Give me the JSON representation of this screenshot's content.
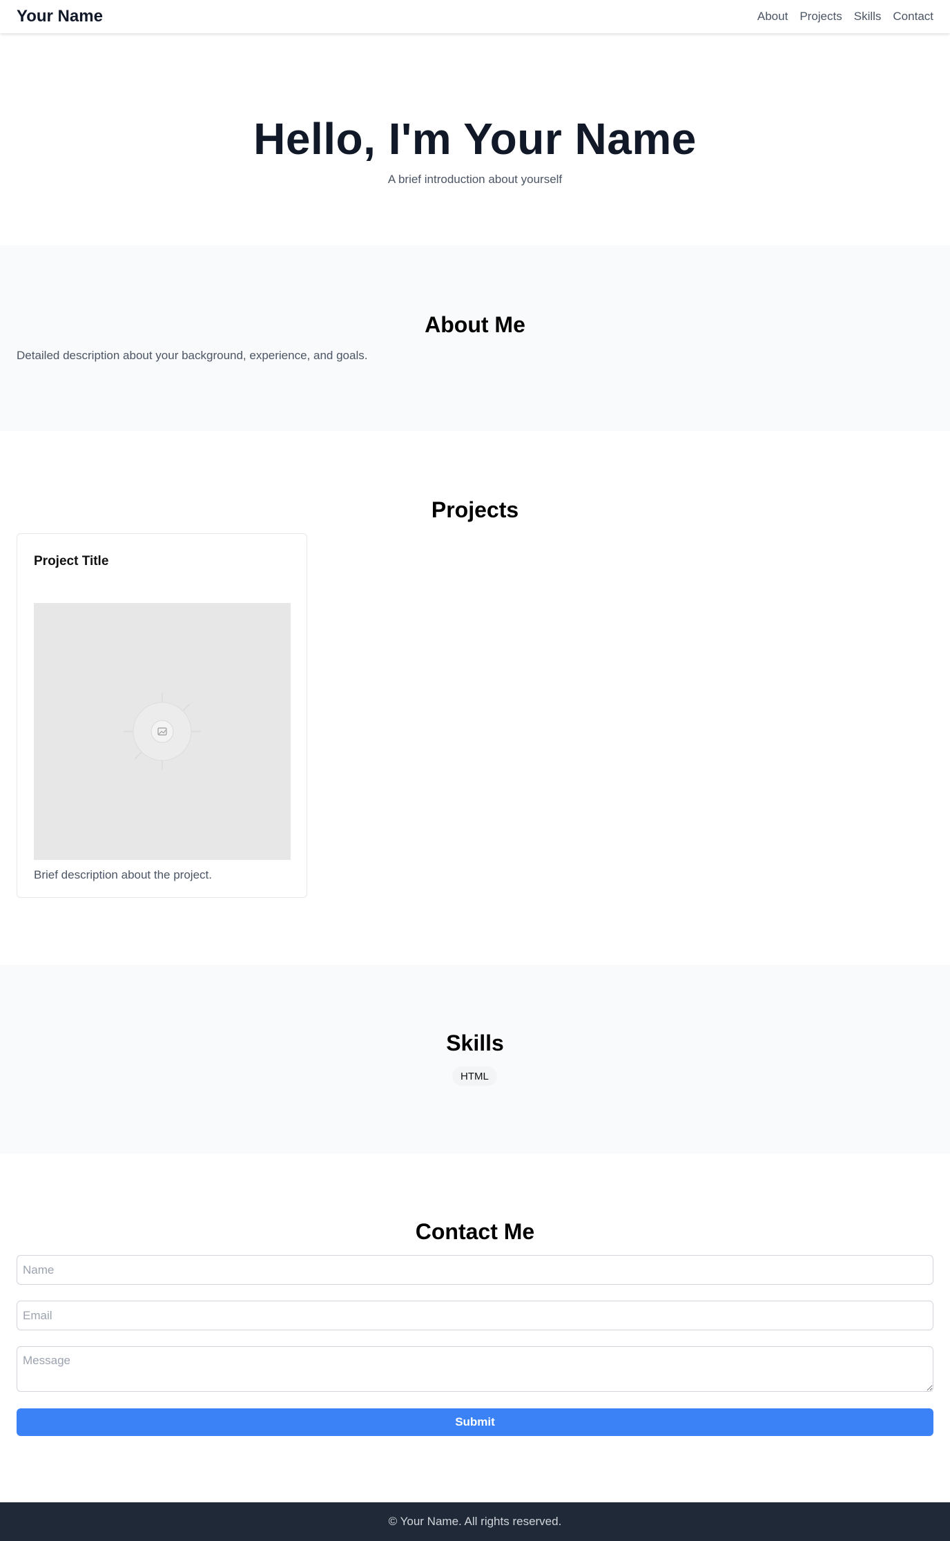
{
  "nav": {
    "brand": "Your Name",
    "links": [
      "About",
      "Projects",
      "Skills",
      "Contact"
    ]
  },
  "hero": {
    "title": "Hello, I'm Your Name",
    "subtitle": "A brief introduction about yourself"
  },
  "about": {
    "heading": "About Me",
    "text": "Detailed description about your background, experience, and goals."
  },
  "projects": {
    "heading": "Projects",
    "items": [
      {
        "title": "Project Title",
        "image_icon": "image-placeholder-icon",
        "description": "Brief description about the project."
      }
    ]
  },
  "skills": {
    "heading": "Skills",
    "items": [
      "HTML"
    ]
  },
  "contact": {
    "heading": "Contact Me",
    "name_placeholder": "Name",
    "email_placeholder": "Email",
    "message_placeholder": "Message",
    "submit_label": "Submit"
  },
  "footer": {
    "text": "© Your Name. All rights reserved."
  },
  "colors": {
    "accent": "#3b82f6",
    "footer_bg": "#1f2937",
    "section_alt_bg": "#f9fafb"
  }
}
